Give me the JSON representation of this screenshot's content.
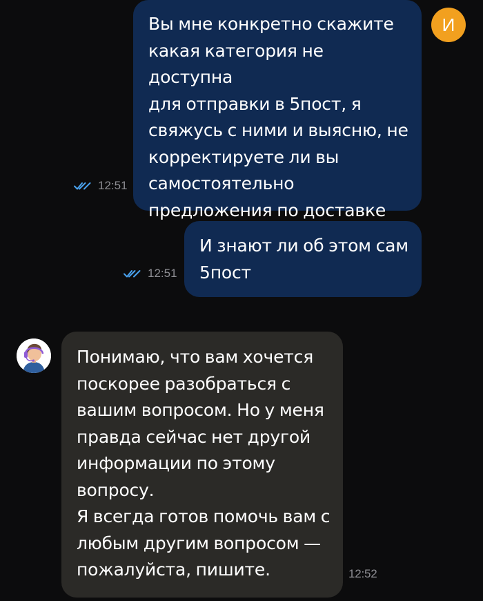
{
  "user": {
    "initial": "И",
    "avatar_color": "#f2a01f"
  },
  "colors": {
    "background": "#0c0c0d",
    "outgoing_bubble": "#102a52",
    "incoming_bubble": "#2b2a27",
    "read_checks": "#4aa3f0"
  },
  "messages": [
    {
      "direction": "outgoing",
      "text": "Вы мне конкретно скажите\nкакая категория не доступна\nдля отправки в 5пост, я\nсвяжусь с ними и выясню, не\nкорректируете ли вы\nсамостоятельно\nпредложения по доставке",
      "time": "12:51",
      "status_icon": "double-check-icon"
    },
    {
      "direction": "outgoing",
      "text": "И знают ли об этом сам\n5пост",
      "time": "12:51",
      "status_icon": "double-check-icon"
    },
    {
      "direction": "incoming",
      "avatar_icon": "support-agent-avatar-icon",
      "text": "Понимаю, что вам хочется\nпоскорее разобраться с\nвашим вопросом. Но у меня\nправда сейчас нет другой\nинформации по этому\nвопросу.\nЯ всегда готов помочь вам с\nлюбым другим вопросом —\nпожалуйста, пишите.",
      "time": "12:52"
    }
  ]
}
